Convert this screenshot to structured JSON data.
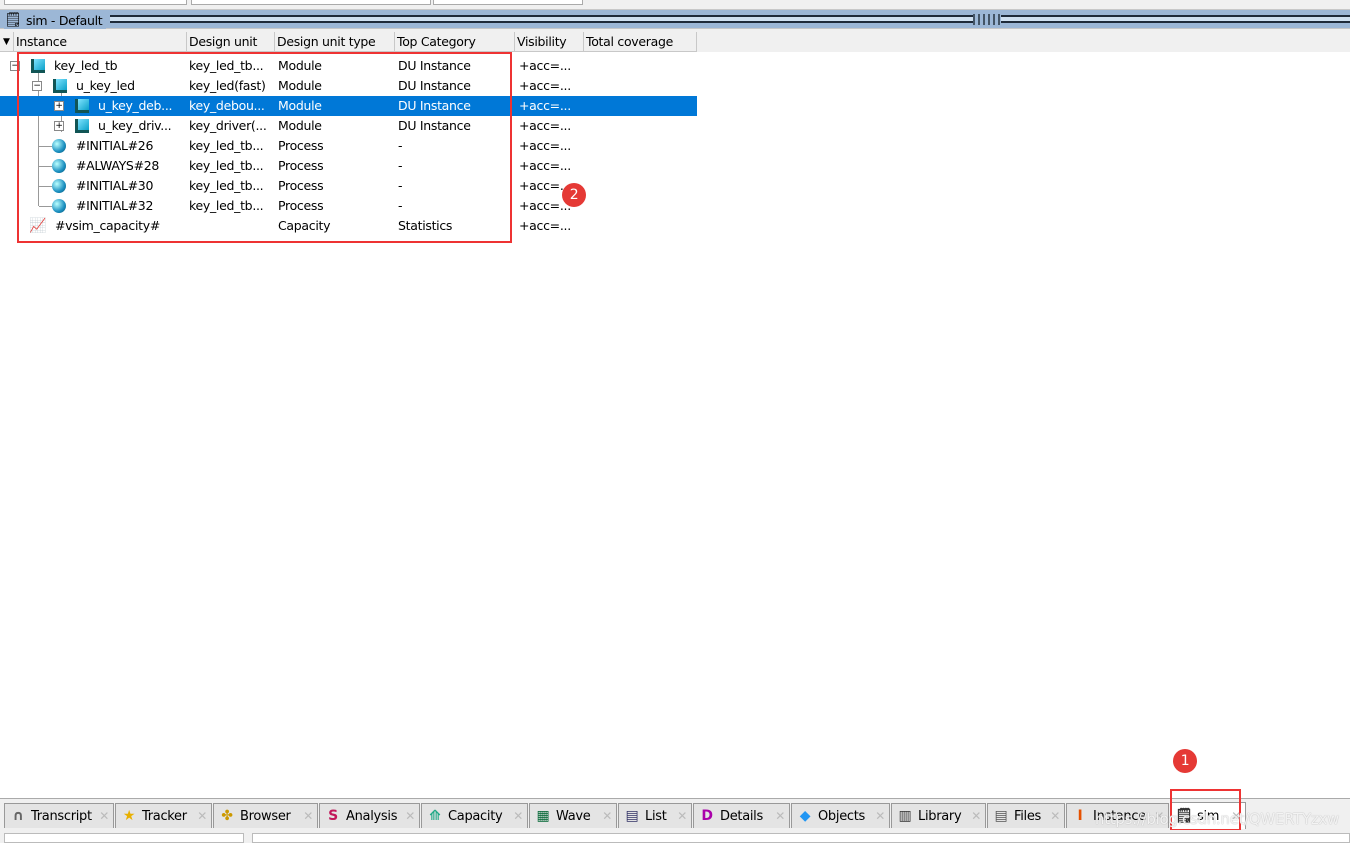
{
  "window": {
    "title": "sim - Default"
  },
  "columns": [
    "Instance",
    "Design unit",
    "Design unit type",
    "Top Category",
    "Visibility",
    "Total coverage"
  ],
  "rows": [
    {
      "instance": "key_led_tb",
      "design_unit": "key_led_tb...",
      "type": "Module",
      "category": "DU Instance",
      "visibility": "+acc=...",
      "coverage": "",
      "icon": "module-icon",
      "expander": "minus",
      "selected": false
    },
    {
      "instance": "u_key_led",
      "design_unit": "key_led(fast)",
      "type": "Module",
      "category": "DU Instance",
      "visibility": "+acc=...",
      "coverage": "",
      "icon": "module-icon",
      "expander": "minus",
      "selected": false
    },
    {
      "instance": "u_key_deb...",
      "design_unit": "key_debou...",
      "type": "Module",
      "category": "DU Instance",
      "visibility": "+acc=...",
      "coverage": "",
      "icon": "module-icon",
      "expander": "plus",
      "selected": true
    },
    {
      "instance": "u_key_driv...",
      "design_unit": "key_driver(...",
      "type": "Module",
      "category": "DU Instance",
      "visibility": "+acc=...",
      "coverage": "",
      "icon": "module-icon",
      "expander": "plus",
      "selected": false
    },
    {
      "instance": "#INITIAL#26",
      "design_unit": "key_led_tb...",
      "type": "Process",
      "category": "-",
      "visibility": "+acc=...",
      "coverage": "",
      "icon": "process-icon",
      "selected": false
    },
    {
      "instance": "#ALWAYS#28",
      "design_unit": "key_led_tb...",
      "type": "Process",
      "category": "-",
      "visibility": "+acc=...",
      "coverage": "",
      "icon": "process-icon",
      "selected": false
    },
    {
      "instance": "#INITIAL#30",
      "design_unit": "key_led_tb...",
      "type": "Process",
      "category": "-",
      "visibility": "+acc=...",
      "coverage": "",
      "icon": "process-icon",
      "selected": false
    },
    {
      "instance": "#INITIAL#32",
      "design_unit": "key_led_tb...",
      "type": "Process",
      "category": "-",
      "visibility": "+acc=...",
      "coverage": "",
      "icon": "process-icon",
      "selected": false
    },
    {
      "instance": "#vsim_capacity#",
      "design_unit": "",
      "type": "Capacity",
      "category": "Statistics",
      "visibility": "+acc=...",
      "coverage": "",
      "icon": "capacity-icon",
      "selected": false
    }
  ],
  "tabs": [
    {
      "label": "Transcript",
      "icon": "transcript-icon"
    },
    {
      "label": "Tracker",
      "icon": "star-icon"
    },
    {
      "label": "Browser",
      "icon": "browser-icon"
    },
    {
      "label": "Analysis",
      "icon": "analysis-icon"
    },
    {
      "label": "Capacity",
      "icon": "capacity-icon"
    },
    {
      "label": "Wave",
      "icon": "wave-icon"
    },
    {
      "label": "List",
      "icon": "list-icon"
    },
    {
      "label": "Details",
      "icon": "details-icon"
    },
    {
      "label": "Objects",
      "icon": "objects-icon"
    },
    {
      "label": "Library",
      "icon": "library-icon"
    },
    {
      "label": "Files",
      "icon": "files-icon"
    },
    {
      "label": "Instance",
      "icon": "instance-icon"
    },
    {
      "label": "sim",
      "icon": "sim-icon",
      "active": true
    }
  ],
  "annotations": {
    "badge1": "1",
    "badge2": "2",
    "accent": "#e53935"
  },
  "watermark": "https://blog.csdn.net/QWERTYzxw",
  "colors": {
    "selection": "#0078d7",
    "titlebar": "#9cb7d6"
  }
}
